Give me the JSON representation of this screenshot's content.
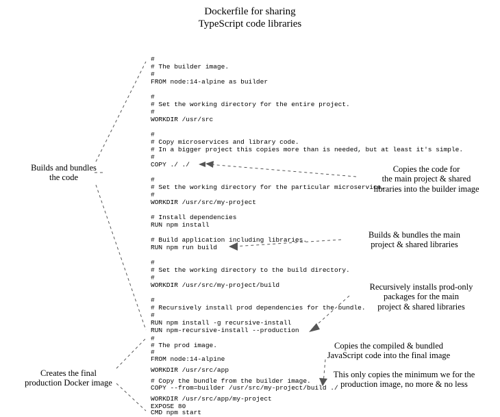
{
  "title_line1": "Dockerfile for sharing",
  "title_line2": "TypeScript code libraries",
  "left_annotations": {
    "builds": "Builds and bundles\nthe code",
    "creates": "Creates the final\nproduction Docker image"
  },
  "right_annotations": {
    "copies_code": "Copies the code for\nthe main project & shared\nlibraries into the builder image",
    "builds_bundles": "Builds & bundles the main\nproject & shared libraries",
    "recursive": "Recursively installs prod-only\npackages for the main\nproject & shared libraries",
    "copies_bundle": "Copies the compiled & bundled\nJavaScript code into the final image",
    "minimum": "This only copies the minimum we for the\nproduction image, no more & no less"
  },
  "code": {
    "l01": "#",
    "l02": "# The builder image.",
    "l03": "#",
    "l04": "FROM node:14-alpine as builder",
    "l05": "",
    "l06": "#",
    "l07": "# Set the working directory for the entire project.",
    "l08": "#",
    "l09": "WORKDIR /usr/src",
    "l10": "",
    "l11": "#",
    "l12": "# Copy microservices and library code.",
    "l13": "# In a bigger project this copies more than is needed, but at least it's simple.",
    "l14": "#",
    "l15": "COPY ./ ./",
    "l16": "",
    "l17": "#",
    "l18": "# Set the working directory for the particular microservice.",
    "l19": "#",
    "l20": "WORKDIR /usr/src/my-project",
    "l21": "",
    "l22": "# Install dependencies",
    "l23": "RUN npm install",
    "l24": "",
    "l25": "# Build application including libraries.",
    "l26": "RUN npm run build",
    "l27": "",
    "l28": "#",
    "l29": "# Set the working directory to the build directory.",
    "l30": "#",
    "l31": "WORKDIR /usr/src/my-project/build",
    "l32": "",
    "l33": "#",
    "l34": "# Recursively install prod dependencies for the bundle.",
    "l35": "#",
    "l36": "RUN npm install -g recursive-install",
    "l37": "RUN npm-recursive-install --production",
    "l38": "",
    "l39": "#",
    "l40": "# The prod image.",
    "l41": "#",
    "l42": "FROM node:14-alpine",
    "l43": "",
    "l44": "WORKDIR /usr/src/app",
    "l45": "",
    "l46": "# Copy the bundle from the builder image.",
    "l47": "COPY --from=builder /usr/src/my-project/build ./",
    "l48": "",
    "l49": "WORKDIR /usr/src/app/my-project",
    "l50": "",
    "l51": "EXPOSE 80",
    "l52": "CMD npm start"
  }
}
